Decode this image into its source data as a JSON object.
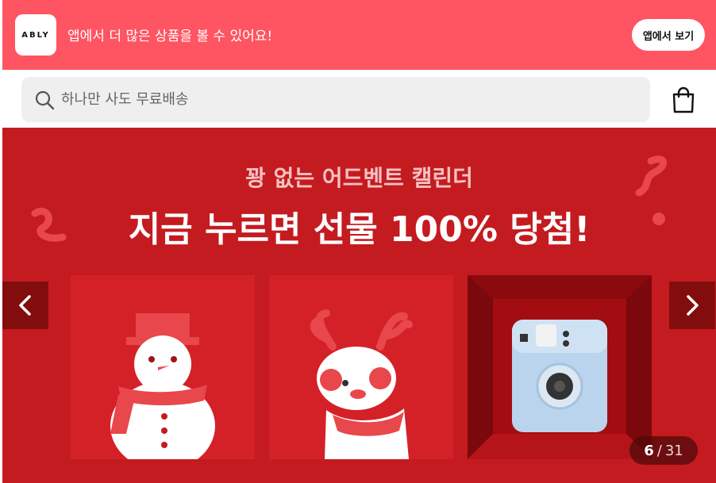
{
  "app_banner": {
    "logo_text": "ABLY",
    "message": "앱에서 더 많은 상품을 볼 수 있어요!",
    "open_app_label": "앱에서 보기",
    "color": "#ff5461"
  },
  "search": {
    "placeholder": "하나만 사도 무료배송",
    "icon": "search-icon"
  },
  "header": {
    "cart_icon": "shopping-bag-icon"
  },
  "hero": {
    "subtitle": "꽝 없는 어드벤트 캘린더",
    "title": "지금 누르면 선물 100% 당첨!",
    "background": "#c41b20",
    "prev_icon": "chevron-left-icon",
    "next_icon": "chevron-right-icon",
    "slides": [
      "snowman",
      "reindeer",
      "instant-camera"
    ],
    "counter": {
      "current": "6",
      "separator": "/",
      "total": "31"
    }
  }
}
